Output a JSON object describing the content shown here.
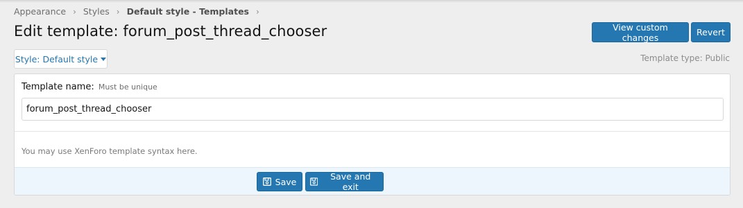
{
  "breadcrumb": {
    "items": [
      "Appearance",
      "Styles",
      "Default style - Templates"
    ],
    "separator": "›"
  },
  "page": {
    "title": "Edit template: forum_post_thread_chooser"
  },
  "header_actions": {
    "view_changes_label": "View custom changes",
    "revert_label": "Revert"
  },
  "style_chooser": {
    "label": "Style: Default style"
  },
  "template_type": "Template type: Public",
  "form": {
    "name_label": "Template name:",
    "name_hint": "Must be unique",
    "name_value": "forum_post_thread_chooser",
    "syntax_hint": "You may use XenForo template syntax here."
  },
  "submit": {
    "save_label": "Save",
    "save_exit_label": "Save and exit"
  },
  "icons": {
    "save": "floppy-disk-icon",
    "caret": "caret-down-icon"
  },
  "colors": {
    "accent": "#2577b1",
    "page_bg": "#eeeeee",
    "submit_bar_bg": "#edf6fd"
  }
}
